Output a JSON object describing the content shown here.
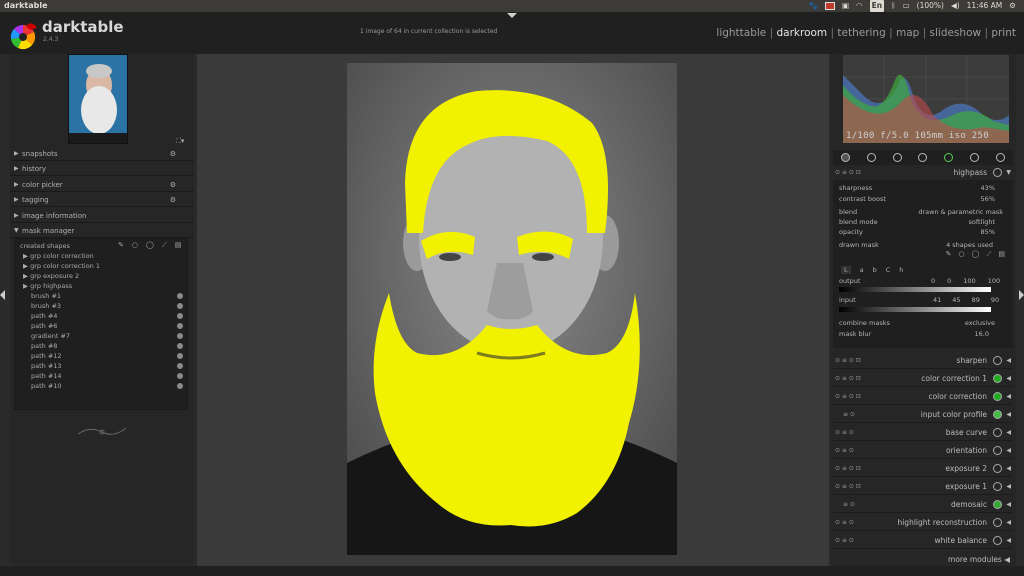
{
  "os": {
    "app_title": "darktable",
    "lang": "En",
    "battery": "(100%)",
    "time": "11:46 AM"
  },
  "header": {
    "app_name": "darktable",
    "version": "2.4.3",
    "status": "1 image of 64 in current collection is selected",
    "views": [
      "lighttable",
      "darkroom",
      "tethering",
      "map",
      "slideshow",
      "print"
    ],
    "active_view": "darkroom"
  },
  "left_panel": {
    "modules": [
      {
        "label": "snapshots",
        "gear": true
      },
      {
        "label": "history",
        "gear": false
      },
      {
        "label": "color picker",
        "gear": true
      },
      {
        "label": "tagging",
        "gear": true
      },
      {
        "label": "image information",
        "gear": false
      },
      {
        "label": "mask manager",
        "gear": false
      }
    ],
    "mask_manager": {
      "header": "created shapes",
      "groups": [
        "grp color correction",
        "grp color correction 1",
        "grp exposure 2",
        "grp highpass"
      ],
      "shapes": [
        "brush #1",
        "brush #3",
        "path #4",
        "path #6",
        "gradient #7",
        "path #8",
        "path #12",
        "path #13",
        "path #14",
        "path #10"
      ]
    }
  },
  "right_panel": {
    "histogram_info": "1/100 f/5.0 105mm iso 250",
    "active_module": "highpass",
    "highpass": {
      "sharpness_label": "sharpness",
      "sharpness_value": "43%",
      "contrast_label": "contrast boost",
      "contrast_value": "56%",
      "blend_label": "blend",
      "blend_value": "drawn & parametric mask",
      "blend_mode_label": "blend mode",
      "blend_mode_value": "softlight",
      "opacity_label": "opacity",
      "opacity_value": "85%",
      "drawn_mask_label": "drawn mask",
      "drawn_mask_value": "4 shapes used",
      "channels": [
        "L",
        "a",
        "b",
        "C",
        "h"
      ],
      "output_label": "output",
      "output_values": [
        "0",
        "0",
        "100",
        "100"
      ],
      "input_label": "input",
      "input_values": [
        "41",
        "45",
        "89",
        "90"
      ],
      "combine_label": "combine masks",
      "combine_value": "exclusive",
      "mask_blur_label": "mask blur",
      "mask_blur_value": "16.0"
    },
    "modules": [
      "sharpen",
      "color correction 1",
      "color correction",
      "input color profile",
      "base curve",
      "orientation",
      "exposure 2",
      "exposure 1",
      "demosaic",
      "highlight reconstruction",
      "white balance"
    ],
    "more_modules": "more modules"
  },
  "colors": {
    "mask_overlay": "#f2f200",
    "background": "#2a2a2a"
  }
}
